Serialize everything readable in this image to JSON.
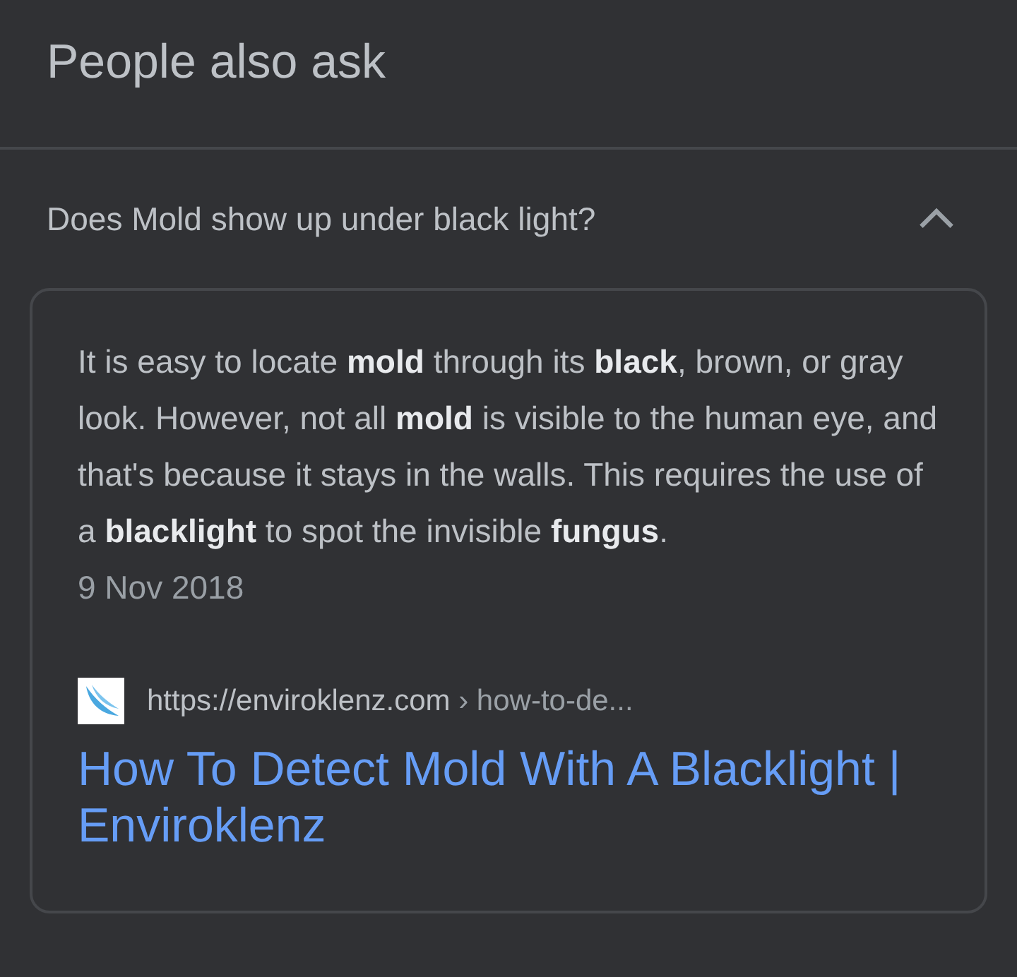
{
  "section_title": "People also ask",
  "questions": [
    {
      "question": "Does Mold show up under black light?",
      "expanded": true,
      "answer": {
        "snippet": "It is easy to locate **mold** through its **black**, brown, or gray look. However, not all **mold** is visible to the human eye, and that's because it stays in the walls. This requires the use of a **blacklight** to spot the invisible **fungus**.",
        "date": "9 Nov 2018",
        "source": {
          "site": "https://enviroklenz.com",
          "path": "› how-to-de..."
        },
        "link_title": "How To Detect Mold With A Blacklight | Enviroklenz"
      }
    }
  ]
}
